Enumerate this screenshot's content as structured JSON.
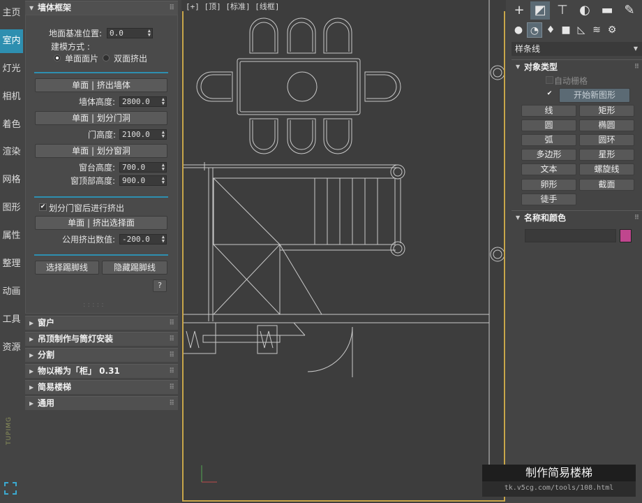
{
  "nav": {
    "items": [
      "主页",
      "室内",
      "灯光",
      "相机",
      "着色",
      "渲染",
      "网格",
      "图形",
      "属性",
      "整理",
      "动画",
      "工具",
      "资源"
    ],
    "active": "室内",
    "brand": "TUPIMG"
  },
  "panel": {
    "title": "墙体框架",
    "floor_label": "地面基准位置:",
    "floor_value": "0.0",
    "mode_label": "建模方式 :",
    "mode_opt1": "单面面片",
    "mode_opt2": "双面挤出",
    "btn_extrude_wall": "单面 | 挤出墙体",
    "wall_height_label": "墙体高度:",
    "wall_height_value": "2800.0",
    "btn_split_door": "单面 | 划分门洞",
    "door_height_label": "门高度:",
    "door_height_value": "2100.0",
    "btn_split_window": "单面 | 划分窗洞",
    "sill_label": "窗台高度:",
    "sill_value": "700.0",
    "top_label": "窗顶部高度:",
    "top_value": "900.0",
    "check_label": "划分门窗后进行挤出",
    "btn_extrude_sel": "单面 | 挤出选择面",
    "common_label": "公用挤出数值:",
    "common_value": "-200.0",
    "btn_select_skirting": "选择踢脚线",
    "btn_hide_skirting": "隐藏踢脚线",
    "help": "?",
    "dots": ": : : : :",
    "collapsed": [
      "窗户",
      "吊顶制作与筒灯安装",
      "分割",
      "物以稀为「柜」 0.31",
      "简易楼梯",
      "通用"
    ]
  },
  "viewport": {
    "label": "[+] [顶] [标准] [线框]"
  },
  "cmd": {
    "category": "样条线",
    "object_type": "对象类型",
    "autogrid": "自动栅格",
    "start_new": "开始新图形",
    "buttons": [
      "线",
      "矩形",
      "圆",
      "椭圆",
      "弧",
      "圆环",
      "多边形",
      "星形",
      "文本",
      "螺旋线",
      "卵形",
      "截面",
      "徒手"
    ],
    "name_color": "名称和颜色",
    "swatch": "#c0468e"
  },
  "overlay": {
    "title": "制作简易楼梯",
    "url": "tk.v5cg.com/tools/108.html"
  },
  "colors": {
    "accent": "#2e8fb0",
    "frame": "#c8a64a"
  }
}
